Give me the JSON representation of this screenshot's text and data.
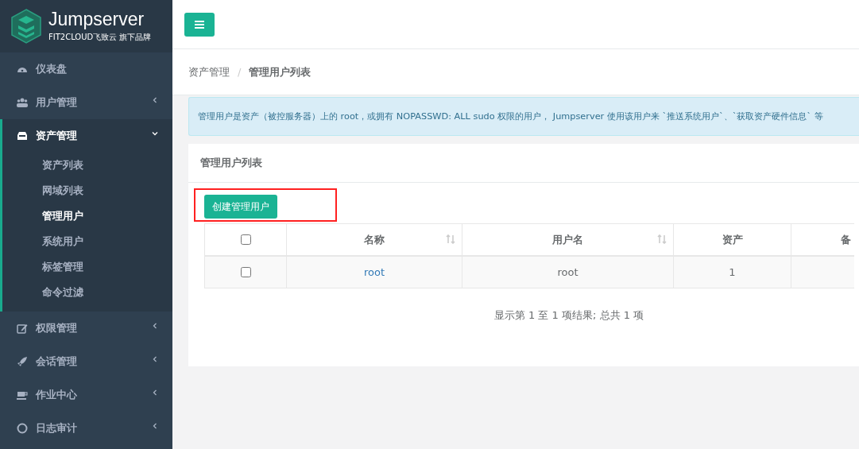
{
  "brand": {
    "name": "Jumpserver",
    "tagline": "FIT2CLOUD飞致云 旗下品牌"
  },
  "sidebar": {
    "items": [
      {
        "label": "仪表盘",
        "expanded": false,
        "has_children": false
      },
      {
        "label": "用户管理",
        "expanded": false,
        "has_children": true
      },
      {
        "label": "资产管理",
        "expanded": true,
        "has_children": true,
        "children": [
          {
            "label": "资产列表",
            "selected": false
          },
          {
            "label": "网域列表",
            "selected": false
          },
          {
            "label": "管理用户",
            "selected": true
          },
          {
            "label": "系统用户",
            "selected": false
          },
          {
            "label": "标签管理",
            "selected": false
          },
          {
            "label": "命令过滤",
            "selected": false
          }
        ]
      },
      {
        "label": "权限管理",
        "expanded": false,
        "has_children": true
      },
      {
        "label": "会话管理",
        "expanded": false,
        "has_children": true
      },
      {
        "label": "作业中心",
        "expanded": false,
        "has_children": true
      },
      {
        "label": "日志审计",
        "expanded": false,
        "has_children": true
      }
    ]
  },
  "breadcrumb": [
    "资产管理",
    "管理用户列表"
  ],
  "breadcrumb_separator": "/",
  "alert": "管理用户是资产（被控服务器）上的 root，或拥有 NOPASSWD: ALL sudo 权限的用户， Jumpserver 使用该用户来 `推送系统用户`、`获取资产硬件信息` 等",
  "card": {
    "title": "管理用户列表",
    "create_button": "创建管理用户",
    "highlighted": true
  },
  "table": {
    "select_all_checked": false,
    "columns": [
      {
        "label": "名称",
        "sortable": true
      },
      {
        "label": "用户名",
        "sortable": true
      },
      {
        "label": "资产",
        "sortable": false
      },
      {
        "label": "备",
        "sortable": false
      }
    ],
    "rows": [
      {
        "checked": false,
        "cells": [
          "root",
          "root",
          "1",
          ""
        ]
      }
    ]
  },
  "pagination": "显示第 1 至 1 项结果; 总共 1 项"
}
